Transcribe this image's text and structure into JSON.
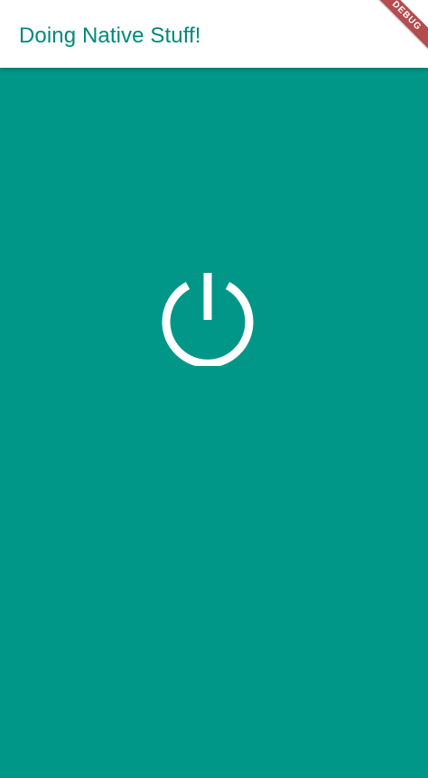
{
  "app_bar": {
    "title": "Doing Native Stuff!"
  },
  "debug_banner": {
    "label": "DEBUG"
  },
  "main": {
    "power_button": {
      "icon": "power-icon"
    }
  },
  "colors": {
    "primary": "#009688",
    "title_text": "#00897b",
    "app_bar_background": "#ffffff",
    "icon": "#ffffff",
    "debug_banner": "#b44d4d"
  }
}
